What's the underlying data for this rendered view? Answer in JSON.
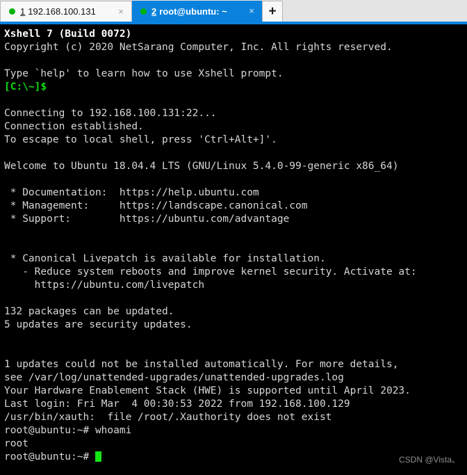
{
  "window": {
    "app_title": "Xshell 7",
    "accent_color": "#0a82dd",
    "terminal_bg": "#000000",
    "terminal_fg": "#d6d6d6",
    "prompt_green": "#10dd10",
    "cursor_color": "#14e414"
  },
  "tabbar": {
    "tabs": [
      {
        "index": "1",
        "label": "192.168.100.131",
        "status_icon": "green-dot-icon",
        "close_icon": "×",
        "active": false
      },
      {
        "index": "2",
        "label": "root@ubuntu: ~",
        "status_icon": "green-dot-icon",
        "close_icon": "×",
        "active": true
      }
    ],
    "new_tab_label": "+",
    "new_tab_icon": "plus-icon"
  },
  "terminal": {
    "lines": [
      {
        "text": "Xshell 7 (Build 0072)",
        "style": "bold"
      },
      {
        "text": "Copyright (c) 2020 NetSarang Computer, Inc. All rights reserved.",
        "style": "normal"
      },
      {
        "text": "",
        "style": "blank"
      },
      {
        "text": "Type `help' to learn how to use Xshell prompt.",
        "style": "normal"
      },
      {
        "text": "[C:\\~]$",
        "style": "green"
      },
      {
        "text": "",
        "style": "blank"
      },
      {
        "text": "Connecting to 192.168.100.131:22...",
        "style": "normal"
      },
      {
        "text": "Connection established.",
        "style": "normal"
      },
      {
        "text": "To escape to local shell, press 'Ctrl+Alt+]'.",
        "style": "normal"
      },
      {
        "text": "",
        "style": "blank"
      },
      {
        "text": "Welcome to Ubuntu 18.04.4 LTS (GNU/Linux 5.4.0-99-generic x86_64)",
        "style": "normal"
      },
      {
        "text": "",
        "style": "blank"
      },
      {
        "text": " * Documentation:  https://help.ubuntu.com",
        "style": "normal"
      },
      {
        "text": " * Management:     https://landscape.canonical.com",
        "style": "normal"
      },
      {
        "text": " * Support:        https://ubuntu.com/advantage",
        "style": "normal"
      },
      {
        "text": "",
        "style": "blank"
      },
      {
        "text": "",
        "style": "blank"
      },
      {
        "text": " * Canonical Livepatch is available for installation.",
        "style": "normal"
      },
      {
        "text": "   - Reduce system reboots and improve kernel security. Activate at:",
        "style": "normal"
      },
      {
        "text": "     https://ubuntu.com/livepatch",
        "style": "normal"
      },
      {
        "text": "",
        "style": "blank"
      },
      {
        "text": "132 packages can be updated.",
        "style": "normal"
      },
      {
        "text": "5 updates are security updates.",
        "style": "normal"
      },
      {
        "text": "",
        "style": "blank"
      },
      {
        "text": "",
        "style": "blank"
      },
      {
        "text": "1 updates could not be installed automatically. For more details,",
        "style": "normal"
      },
      {
        "text": "see /var/log/unattended-upgrades/unattended-upgrades.log",
        "style": "normal"
      },
      {
        "text": "Your Hardware Enablement Stack (HWE) is supported until April 2023.",
        "style": "normal"
      },
      {
        "text": "Last login: Fri Mar  4 00:30:53 2022 from 192.168.100.129",
        "style": "normal"
      },
      {
        "text": "/usr/bin/xauth:  file /root/.Xauthority does not exist",
        "style": "normal"
      },
      {
        "text": "root@ubuntu:~# whoami",
        "style": "normal"
      },
      {
        "text": "root",
        "style": "normal"
      }
    ],
    "prompt": "root@ubuntu:~# ",
    "input_value": ""
  },
  "watermark": {
    "text": "CSDN @Vista、"
  }
}
